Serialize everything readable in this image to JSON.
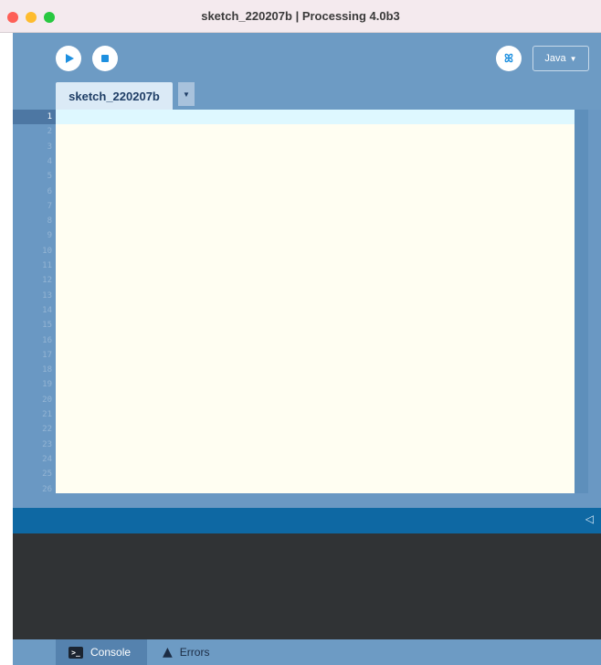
{
  "window": {
    "title": "sketch_220207b | Processing 4.0b3"
  },
  "toolbar": {
    "run_icon": "play-icon",
    "stop_icon": "stop-icon",
    "debug_icon": "debug-butterfly-icon",
    "debug_glyph": "ꕤ",
    "mode_label": "Java",
    "mode_arrow": "▼"
  },
  "tabs": [
    {
      "label": "sketch_220207b",
      "active": true
    }
  ],
  "tab_menu_arrow": "▼",
  "editor": {
    "line_numbers": [
      "1",
      "2",
      "3",
      "4",
      "5",
      "6",
      "7",
      "8",
      "9",
      "10",
      "11",
      "12",
      "13",
      "14",
      "15",
      "16",
      "17",
      "18",
      "19",
      "20",
      "21",
      "22",
      "23",
      "24",
      "25",
      "26"
    ],
    "current_line": 1,
    "content": ""
  },
  "statusbar": {
    "collapse_arrow": "◁"
  },
  "footer": {
    "console_label": "Console",
    "console_glyph": ">_",
    "errors_label": "Errors",
    "errors_glyph": "▲"
  },
  "colors": {
    "toolbar": "#6d9bc4",
    "editor_bg": "#fffef2",
    "current_line": "#def8ff",
    "status_bar": "#0e68a3",
    "console_bg": "#303335",
    "accent": "#1e90e0"
  }
}
